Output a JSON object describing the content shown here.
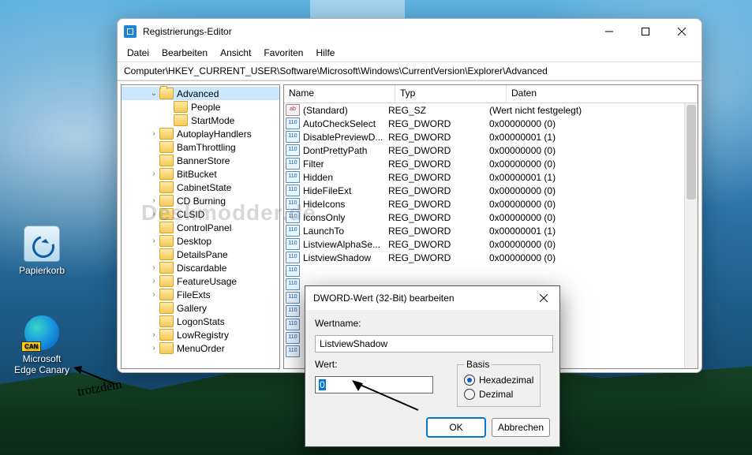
{
  "desktop": {
    "recycle_bin": "Papierkorb",
    "edge_canary": "Microsoft Edge Canary",
    "edge_badge": "CAN",
    "annot": "trotzdem"
  },
  "window": {
    "title": "Registrierungs-Editor",
    "menus": [
      "Datei",
      "Bearbeiten",
      "Ansicht",
      "Favoriten",
      "Hilfe"
    ],
    "address": "Computer\\HKEY_CURRENT_USER\\Software\\Microsoft\\Windows\\CurrentVersion\\Explorer\\Advanced",
    "tree": [
      {
        "ind": 34,
        "exp": "v",
        "name": "Advanced",
        "sel": true,
        "open": true
      },
      {
        "ind": 52,
        "exp": "",
        "name": "People"
      },
      {
        "ind": 52,
        "exp": "",
        "name": "StartMode"
      },
      {
        "ind": 34,
        "exp": ">",
        "name": "AutoplayHandlers"
      },
      {
        "ind": 34,
        "exp": "",
        "name": "BamThrottling"
      },
      {
        "ind": 34,
        "exp": "",
        "name": "BannerStore"
      },
      {
        "ind": 34,
        "exp": ">",
        "name": "BitBucket"
      },
      {
        "ind": 34,
        "exp": "",
        "name": "CabinetState"
      },
      {
        "ind": 34,
        "exp": ">",
        "name": "CD Burning"
      },
      {
        "ind": 34,
        "exp": ">",
        "name": "CLSID"
      },
      {
        "ind": 34,
        "exp": "",
        "name": "ControlPanel"
      },
      {
        "ind": 34,
        "exp": ">",
        "name": "Desktop"
      },
      {
        "ind": 34,
        "exp": "",
        "name": "DetailsPane"
      },
      {
        "ind": 34,
        "exp": ">",
        "name": "Discardable"
      },
      {
        "ind": 34,
        "exp": ">",
        "name": "FeatureUsage"
      },
      {
        "ind": 34,
        "exp": ">",
        "name": "FileExts"
      },
      {
        "ind": 34,
        "exp": "",
        "name": "Gallery"
      },
      {
        "ind": 34,
        "exp": "",
        "name": "LogonStats"
      },
      {
        "ind": 34,
        "exp": ">",
        "name": "LowRegistry"
      },
      {
        "ind": 34,
        "exp": ">",
        "name": "MenuOrder"
      }
    ],
    "cols": {
      "name": "Name",
      "type": "Typ",
      "data": "Daten"
    },
    "rows": [
      {
        "ab": true,
        "name": "(Standard)",
        "type": "REG_SZ",
        "data": "(Wert nicht festgelegt)"
      },
      {
        "name": "AutoCheckSelect",
        "type": "REG_DWORD",
        "data": "0x00000000 (0)"
      },
      {
        "name": "DisablePreviewD...",
        "type": "REG_DWORD",
        "data": "0x00000001 (1)"
      },
      {
        "name": "DontPrettyPath",
        "type": "REG_DWORD",
        "data": "0x00000000 (0)"
      },
      {
        "name": "Filter",
        "type": "REG_DWORD",
        "data": "0x00000000 (0)"
      },
      {
        "name": "Hidden",
        "type": "REG_DWORD",
        "data": "0x00000001 (1)"
      },
      {
        "name": "HideFileExt",
        "type": "REG_DWORD",
        "data": "0x00000000 (0)"
      },
      {
        "name": "HideIcons",
        "type": "REG_DWORD",
        "data": "0x00000000 (0)"
      },
      {
        "name": "IconsOnly",
        "type": "REG_DWORD",
        "data": "0x00000000 (0)"
      },
      {
        "name": "LaunchTo",
        "type": "REG_DWORD",
        "data": "0x00000001 (1)"
      },
      {
        "name": "ListviewAlphaSe...",
        "type": "REG_DWORD",
        "data": "0x00000000 (0)"
      },
      {
        "name": "ListviewShadow",
        "type": "REG_DWORD",
        "data": "0x00000000 (0)"
      },
      {
        "name": "",
        "type": "",
        "data": ""
      },
      {
        "name": "",
        "type": "",
        "data": ""
      },
      {
        "name": "",
        "type": "",
        "data": ""
      },
      {
        "name": "",
        "type": "",
        "data": ""
      },
      {
        "name": "",
        "type": "",
        "data": ""
      },
      {
        "name": "",
        "type": "",
        "data": ""
      },
      {
        "name": "",
        "type": "",
        "data": ""
      }
    ],
    "watermark": "Deskmodder.de"
  },
  "dialog": {
    "title": "DWORD-Wert (32-Bit) bearbeiten",
    "name_label": "Wertname:",
    "name_value": "ListviewShadow",
    "value_label": "Wert:",
    "value": "0",
    "basis_label": "Basis",
    "hex": "Hexadezimal",
    "dec": "Dezimal",
    "ok": "OK",
    "cancel": "Abbrechen"
  }
}
